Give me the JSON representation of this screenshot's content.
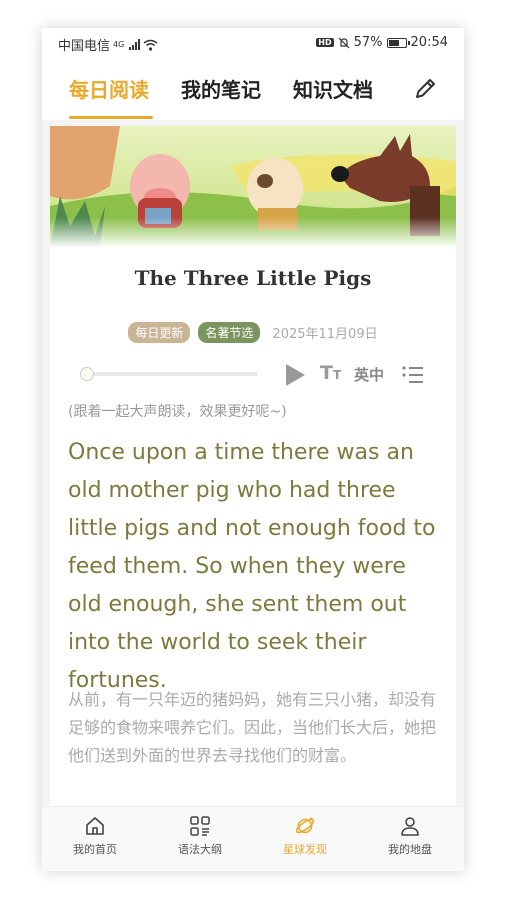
{
  "status_bar": {
    "carrier": "中国电信",
    "network": "4G",
    "battery": "57%",
    "time": "20:54"
  },
  "tabs": [
    {
      "label": "每日阅读",
      "active": true
    },
    {
      "label": "我的笔记",
      "active": false
    },
    {
      "label": "知识文档",
      "active": false
    }
  ],
  "article": {
    "title": "The Three Little Pigs",
    "badges": [
      "每日更新",
      "名著节选"
    ],
    "date": "2025年11月09日",
    "player": {
      "progress": 0,
      "font_label": "T",
      "font_label_small": "T",
      "lang_label": "英中"
    },
    "hint": "(跟着一起大声朗读，效果更好呢~)",
    "english": "Once upon a time there was an old mother pig who had three little pigs and not enough food to feed them. So when they were old enough, she sent them out into the world to seek their fortunes.",
    "chinese": "从前，有一只年迈的猪妈妈，她有三只小猪，却没有足够的食物来喂养它们。因此，当他们长大后，她把他们送到外面的世界去寻找他们的财富。"
  },
  "bottom_nav": [
    {
      "label": "我的首页",
      "icon": "home-icon",
      "active": false
    },
    {
      "label": "语法大纲",
      "icon": "grid-icon",
      "active": false
    },
    {
      "label": "星球发现",
      "icon": "planet-icon",
      "active": true
    },
    {
      "label": "我的地盘",
      "icon": "person-icon",
      "active": false
    }
  ],
  "colors": {
    "accent": "#e9a92a",
    "english_text": "#7d7a3e",
    "badge_daily": "#c9b496",
    "badge_classic": "#7b9560"
  }
}
